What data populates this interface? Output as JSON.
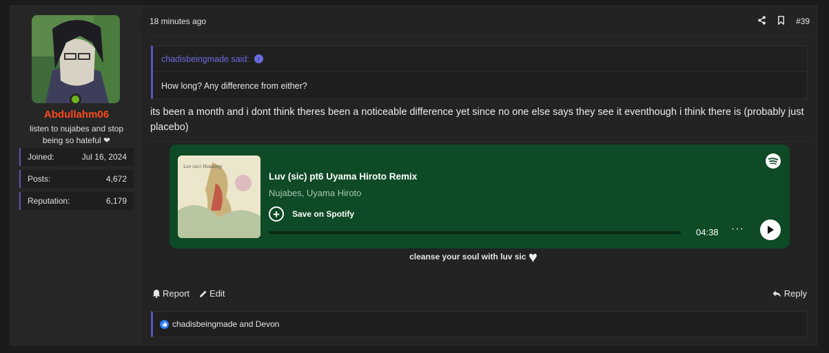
{
  "user": {
    "name": "Abdullahm06",
    "title": "listen to nujabes and stop being so hateful",
    "stats": [
      {
        "label": "Joined:",
        "value": "Jul 16, 2024"
      },
      {
        "label": "Posts:",
        "value": "4,672"
      },
      {
        "label": "Reputation:",
        "value": "6,179"
      }
    ]
  },
  "post": {
    "time": "18 minutes ago",
    "number": "#39",
    "quote": {
      "author": "chadisbeingmade said:",
      "text": "How long? Any difference from either?"
    },
    "message": "its been a month and i dont think theres been a noticeable difference yet since no one else says they see it eventhough i think there is (probably just placebo)"
  },
  "spotify": {
    "title": "Luv (sic) pt6 Uyama Hiroto Remix",
    "artists": "Nujabes, Uyama Hiroto",
    "save_label": "Save on Spotify",
    "duration": "04:38",
    "more": "···"
  },
  "signature": "cleanse your soul with luv sic",
  "footer": {
    "report": "Report",
    "edit": "Edit",
    "reply": "Reply"
  },
  "reactions": "chadisbeingmade and Devon",
  "colors": {
    "username": "#ff4a1c",
    "accent": "#5656c0",
    "spotify_bg": "#0e4a25",
    "online": "#6fb31f"
  }
}
